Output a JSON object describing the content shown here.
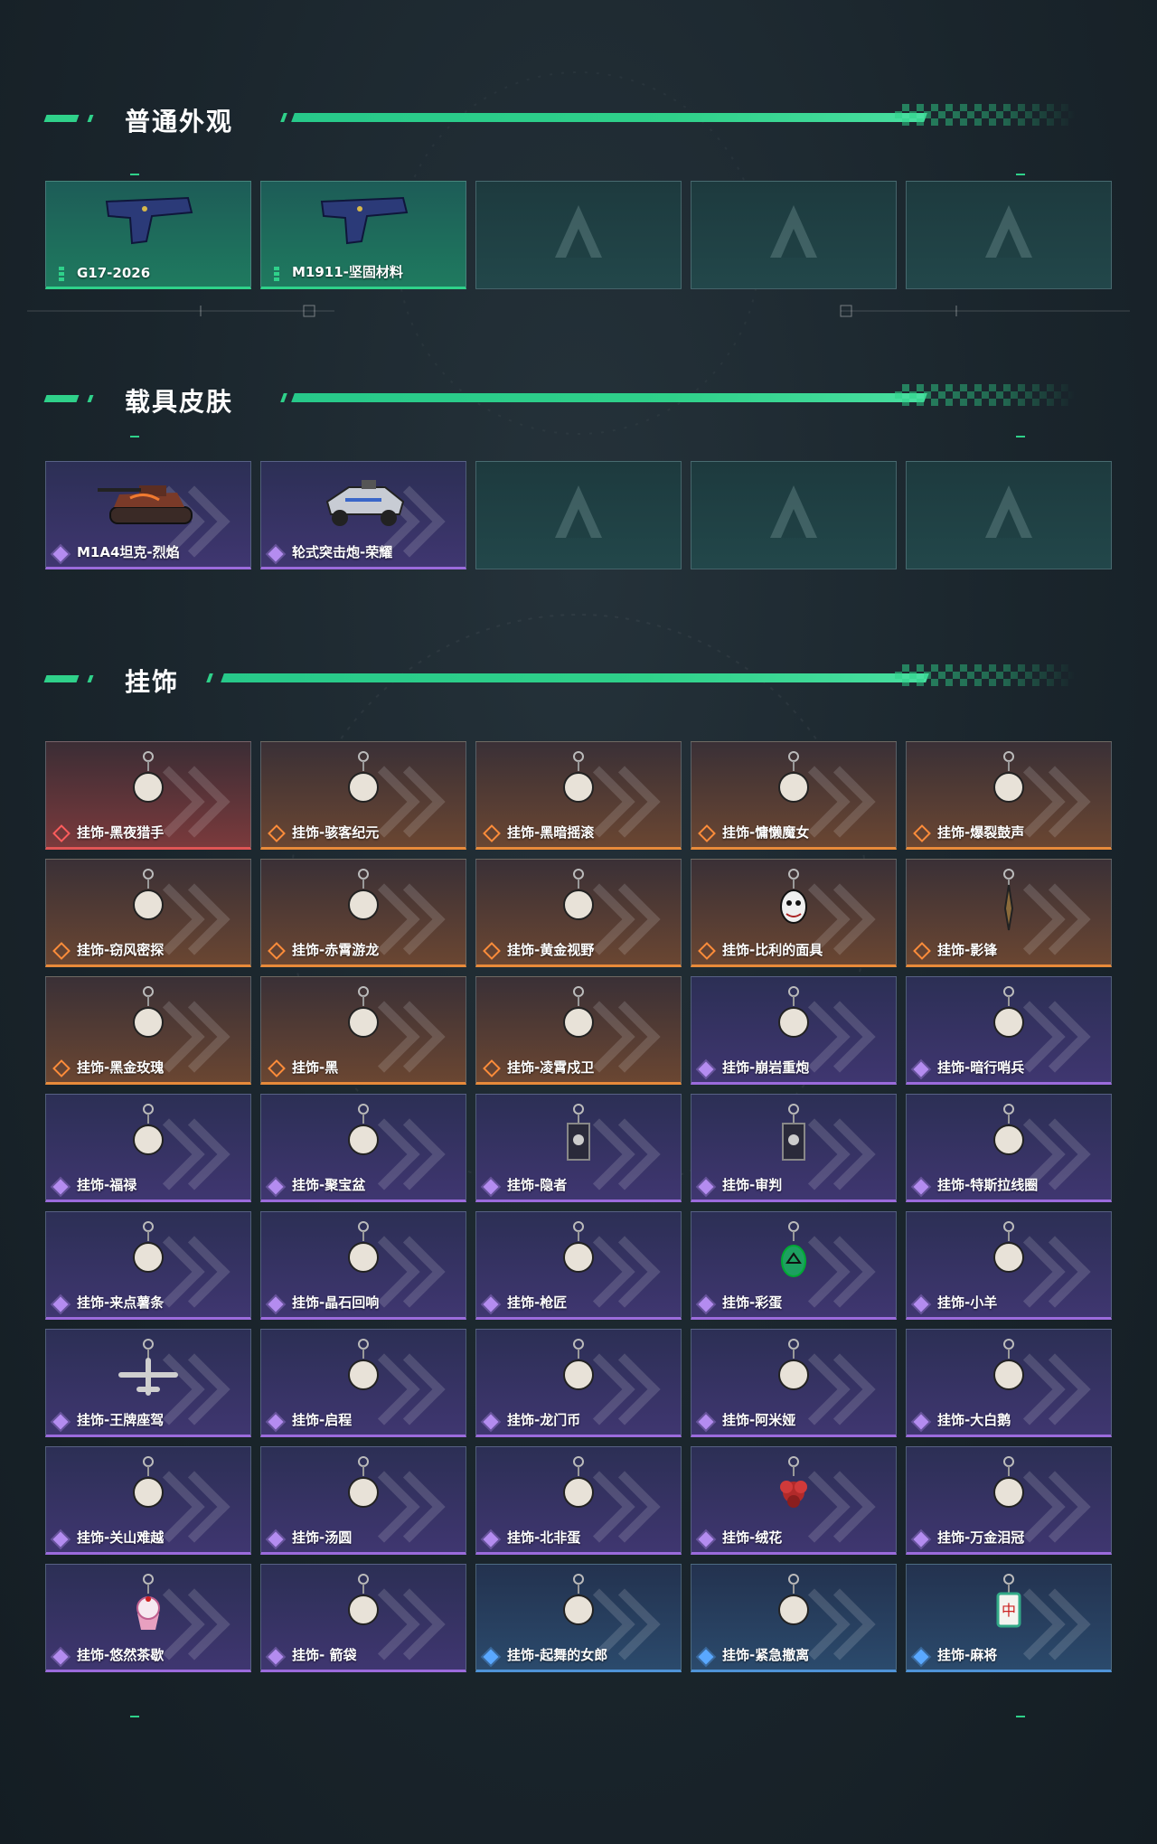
{
  "sections": [
    {
      "title": "普通外观",
      "cards": [
        {
          "label": "G17-2026",
          "rarity": "green",
          "art": "pistol-icon"
        },
        {
          "label": "M1911-坚固材料",
          "rarity": "green",
          "art": "pistol-icon"
        },
        {
          "label": "",
          "rarity": "empty",
          "art": "placeholder-logo-icon"
        },
        {
          "label": "",
          "rarity": "empty",
          "art": "placeholder-logo-icon"
        },
        {
          "label": "",
          "rarity": "empty",
          "art": "placeholder-logo-icon"
        }
      ]
    },
    {
      "title": "载具皮肤",
      "cards": [
        {
          "label": "M1A4坦克-烈焰",
          "rarity": "purple",
          "art": "tank-icon"
        },
        {
          "label": "轮式突击炮-荣耀",
          "rarity": "purple",
          "art": "armored-car-icon"
        },
        {
          "label": "",
          "rarity": "empty",
          "art": "placeholder-logo-icon"
        },
        {
          "label": "",
          "rarity": "empty",
          "art": "placeholder-logo-icon"
        },
        {
          "label": "",
          "rarity": "empty",
          "art": "placeholder-logo-icon"
        }
      ]
    },
    {
      "title": "挂饰",
      "cards": [
        {
          "label": "挂饰-黑夜猎手",
          "rarity": "red",
          "art": "charm-icon"
        },
        {
          "label": "挂饰-骇客纪元",
          "rarity": "orange",
          "art": "charm-icon"
        },
        {
          "label": "挂饰-黑暗摇滚",
          "rarity": "orange",
          "art": "charm-icon"
        },
        {
          "label": "挂饰-慵懒魔女",
          "rarity": "orange",
          "art": "charm-icon"
        },
        {
          "label": "挂饰-爆裂鼓声",
          "rarity": "orange",
          "art": "charm-icon"
        },
        {
          "label": "挂饰-窃风密探",
          "rarity": "orange",
          "art": "charm-icon"
        },
        {
          "label": "挂饰-赤霄游龙",
          "rarity": "orange",
          "art": "charm-icon"
        },
        {
          "label": "挂饰-黄金视野",
          "rarity": "orange",
          "art": "charm-icon"
        },
        {
          "label": "挂饰-比利的面具",
          "rarity": "orange",
          "art": "mask-charm-icon"
        },
        {
          "label": "挂饰-影锋",
          "rarity": "orange",
          "art": "blade-charm-icon"
        },
        {
          "label": "挂饰-黑金玫瑰",
          "rarity": "orange",
          "art": "charm-icon"
        },
        {
          "label": "挂饰-黑",
          "rarity": "orange",
          "art": "charm-icon"
        },
        {
          "label": "挂饰-凌霄戍卫",
          "rarity": "orange",
          "art": "charm-icon"
        },
        {
          "label": "挂饰-崩岩重炮",
          "rarity": "purple",
          "art": "charm-icon"
        },
        {
          "label": "挂饰-暗行哨兵",
          "rarity": "purple",
          "art": "charm-icon"
        },
        {
          "label": "挂饰-福禄",
          "rarity": "purple",
          "art": "charm-icon"
        },
        {
          "label": "挂饰-聚宝盆",
          "rarity": "purple",
          "art": "charm-icon"
        },
        {
          "label": "挂饰-隐者",
          "rarity": "purple",
          "art": "card-charm-icon"
        },
        {
          "label": "挂饰-审判",
          "rarity": "purple",
          "art": "card-charm-icon"
        },
        {
          "label": "挂饰-特斯拉线圈",
          "rarity": "purple",
          "art": "charm-icon"
        },
        {
          "label": "挂饰-来点薯条",
          "rarity": "purple",
          "art": "charm-icon"
        },
        {
          "label": "挂饰-晶石回响",
          "rarity": "purple",
          "art": "charm-icon"
        },
        {
          "label": "挂饰-枪匠",
          "rarity": "purple",
          "art": "charm-icon"
        },
        {
          "label": "挂饰-彩蛋",
          "rarity": "purple",
          "art": "egg-charm-icon"
        },
        {
          "label": "挂饰-小羊",
          "rarity": "purple",
          "art": "charm-icon"
        },
        {
          "label": "挂饰-王牌座驾",
          "rarity": "purple",
          "art": "plane-charm-icon"
        },
        {
          "label": "挂饰-启程",
          "rarity": "purple",
          "art": "charm-icon"
        },
        {
          "label": "挂饰-龙门币",
          "rarity": "purple",
          "art": "charm-icon"
        },
        {
          "label": "挂饰-阿米娅",
          "rarity": "purple",
          "art": "charm-icon"
        },
        {
          "label": "挂饰-大白鹅",
          "rarity": "purple",
          "art": "charm-icon"
        },
        {
          "label": "挂饰-关山难越",
          "rarity": "purple",
          "art": "charm-icon"
        },
        {
          "label": "挂饰-汤圆",
          "rarity": "purple",
          "art": "charm-icon"
        },
        {
          "label": "挂饰-北非蛋",
          "rarity": "purple",
          "art": "charm-icon"
        },
        {
          "label": "挂饰-绒花",
          "rarity": "purple",
          "art": "flower-charm-icon"
        },
        {
          "label": "挂饰-万金泪冠",
          "rarity": "purple",
          "art": "charm-icon"
        },
        {
          "label": "挂饰-悠然茶歇",
          "rarity": "purple",
          "art": "cupcake-charm-icon"
        },
        {
          "label": "挂饰- 箭袋",
          "rarity": "purple",
          "art": "charm-icon"
        },
        {
          "label": "挂饰-起舞的女郎",
          "rarity": "blue",
          "art": "charm-icon"
        },
        {
          "label": "挂饰-紧急撤离",
          "rarity": "blue",
          "art": "charm-icon"
        },
        {
          "label": "挂饰-麻将",
          "rarity": "blue",
          "art": "mahjong-charm-icon"
        }
      ]
    }
  ],
  "colors": {
    "accent": "#2fd18a",
    "green": "#2fd18a",
    "purple": "#9b6bdc",
    "orange": "#e88a3a",
    "red": "#e05555",
    "blue": "#4f93d8"
  }
}
